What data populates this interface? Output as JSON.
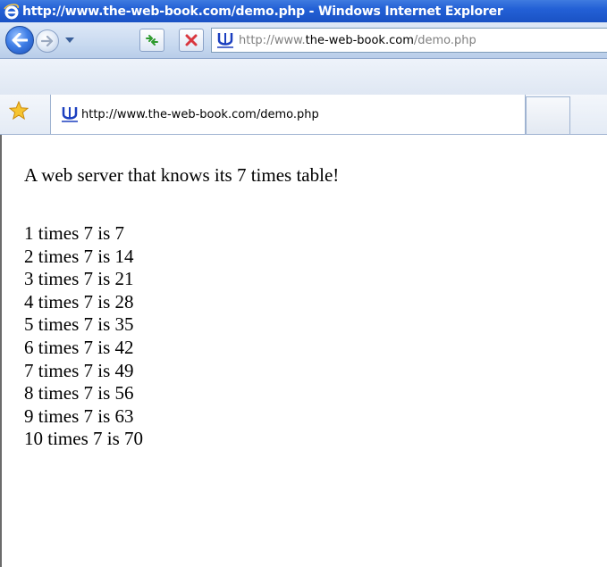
{
  "window": {
    "title": "http://www.the-web-book.com/demo.php - Windows Internet Explorer"
  },
  "navigation": {
    "address_prefix": "http://www.",
    "address_domain": "the-web-book.com",
    "address_suffix": "/demo.php",
    "icons": {
      "back": "back-arrow-icon",
      "forward": "forward-arrow-icon",
      "dropdown": "chevron-down-icon",
      "refresh": "refresh-icon",
      "stop": "stop-icon",
      "site": "site-favicon"
    }
  },
  "tabs": {
    "active_label": "http://www.the-web-book.com/demo.php",
    "favorites_icon": "favorites-star-icon"
  },
  "page": {
    "heading": "A web server that knows its 7 times table!",
    "lines": [
      "1 times 7 is 7",
      "2 times 7 is 14",
      "3 times 7 is 21",
      "4 times 7 is 28",
      "5 times 7 is 35",
      "6 times 7 is 42",
      "7 times 7 is 49",
      "8 times 7 is 56",
      "9 times 7 is 63",
      "10 times 7 is 70"
    ]
  },
  "colors": {
    "titlebar": "#2360d6",
    "toolbar": "#c9daf0",
    "refresh_arrows": "#2e9a2e",
    "stop_x": "#d9363e",
    "site_icon": "#1b3fbf"
  }
}
